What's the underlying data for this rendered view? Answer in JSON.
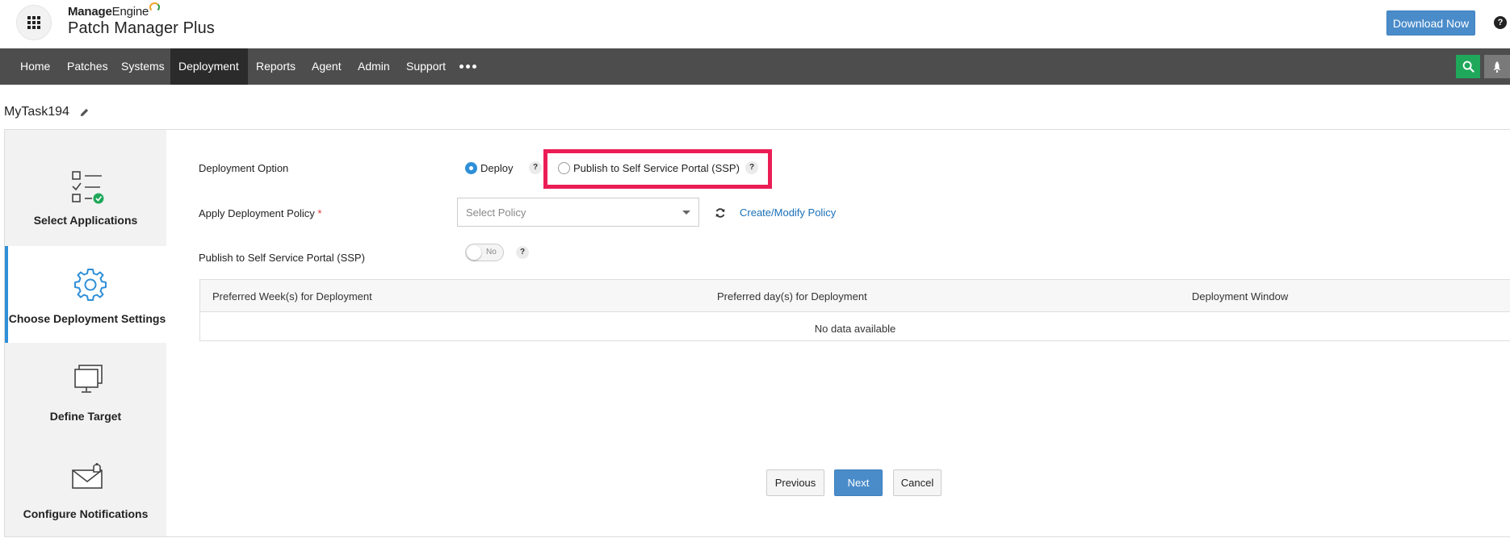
{
  "brand": {
    "company_bold": "Manage",
    "company_light": "Engine",
    "product": "Patch Manager Plus"
  },
  "header": {
    "download_label": "Download Now",
    "help_glyph": "?"
  },
  "nav": {
    "items": [
      "Home",
      "Patches",
      "Systems",
      "Deployment",
      "Reports",
      "Agent",
      "Admin",
      "Support"
    ],
    "active": "Deployment"
  },
  "task": {
    "title": "MyTask194"
  },
  "steps": [
    {
      "label": "Select Applications",
      "icon": "checklist-icon"
    },
    {
      "label": "Choose Deployment Settings",
      "icon": "gear-icon"
    },
    {
      "label": "Define Target",
      "icon": "monitor-icon"
    },
    {
      "label": "Configure Notifications",
      "icon": "envelope-icon"
    }
  ],
  "form": {
    "deployment_option_label": "Deployment Option",
    "option_deploy": "Deploy",
    "option_ssp": "Publish to Self Service Portal (SSP)",
    "help_glyph": "?",
    "policy_label": "Apply Deployment Policy",
    "required_mark": "*",
    "policy_placeholder": "Select Policy",
    "policy_link": "Create/Modify Policy",
    "ssp_toggle_label": "Publish to Self Service Portal (SSP)",
    "ssp_toggle_value": "No"
  },
  "table": {
    "columns": [
      "Preferred Week(s) for Deployment",
      "Preferred day(s) for Deployment",
      "Deployment Window"
    ],
    "empty_message": "No data available"
  },
  "actions": {
    "previous": "Previous",
    "next": "Next",
    "cancel": "Cancel"
  },
  "colors": {
    "accent": "#4a8cca",
    "active_step_border": "#2f8fd8",
    "highlight": "#eb1d55",
    "navbar": "#4d4d4d",
    "search_button": "#1fa85a"
  }
}
